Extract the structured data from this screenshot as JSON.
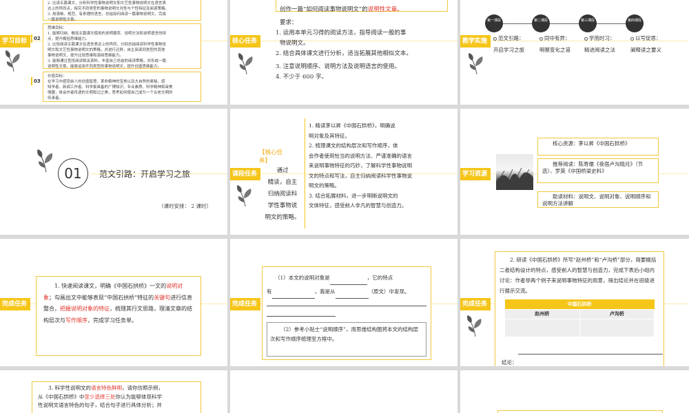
{
  "s1": {
    "label": "学习目标",
    "top_lines": [
      "2. 比读五篇课文，分析科学性事物说明文和文艺性事物说明文在语言表",
      "达上的异同点，探究不同类型的事物说明文共性与个性特征及阅读策略。",
      "3. 用清晰、规范、有条理的语言，总结如何阅读一篇事物说明文，完成",
      "一篇说明性文章。"
    ],
    "n02": "02",
    "box2_title": "思维目标：",
    "box2_lines": [
      "1. 能够归纳、概括五篇课文使用的说明顺序、说明方法和说明语言的特",
      "点，提升概括思维能力。",
      "2. 比较阅读五篇课文在语言表达上的异同，分别总结阅读科学性事物说",
      "明文和文艺性事物说明文的策略，并进行迁移，自主阅读同类型的其他",
      "事物说明文，提升比较思维和演绎思维能力。",
      "3. 能够通过查找阅读相关资料，丰富自己总结的阅读策略，并形成一篇",
      "说明性文章，能够运用不同类型的事物说明文，提升创造思维能力。"
    ],
    "n03": "03",
    "box3_title": "价值目标：",
    "box3_lines": [
      "在学习中感受前人的创造智慧、革命精神的宝贵以及大自然的奥秘，感",
      "知学者、新闻工作者、科学家具备的广博知识、专业素质、科学精神和审美",
      "情趣，体会作者传递的文明和记之美，思考如何使自己成为一个古老文明的",
      "传承者。"
    ]
  },
  "s2": {
    "label": "核心任务",
    "top_text": "创作一篇“如何阅读事物说明文”的",
    "top_red": "说明性文章。",
    "req_title": "要求：",
    "reqs": [
      "1. 运用本单元习得的阅读方法，指导阅读一般的事",
      "物说明文。",
      "2. 结合具体课文进行分析，适当拓展其他相似文本。",
      "3. 注意说明顺序、说明方法及说明语言的使用。",
      "4. 不少于 600 字。"
    ]
  },
  "s3": {
    "label": "教学实施",
    "stages": [
      {
        "circle": "第一课段",
        "name": "范文引路：",
        "sub": "开启学习之旅"
      },
      {
        "circle": "第二课段",
        "name": "同中有异：",
        "sub": "明察变化之道"
      },
      {
        "circle": "第三课段",
        "name": "学而时习：",
        "sub": "精进阅读之法"
      },
      {
        "circle": "第四课段",
        "name": "以写促思：",
        "sub": "阐释读之要义"
      }
    ]
  },
  "s4": {
    "num": "01",
    "title": "范文引路：开启学习之旅",
    "schedule": "（课时安排： 2 课时）"
  },
  "s5": {
    "label": "课段任务",
    "core_tag": "【核心任务】",
    "core_lines": [
      "通过",
      "精读，自主",
      "归纳阅读科",
      "学性事物说",
      "明文的策略。"
    ],
    "tasks": [
      "1. 精读茅以昇《中国石拱桥》，明确说",
      "明对象及其特征。",
      "2. 梳理课文的结构层次和写作顺序，体",
      "会作者使用恰当的说明方法、严谨准确的语言",
      "来说明事物特征的巧妙，了解科学性事物说明",
      "文的特点和写法，自主归纳阅读科学性事物说",
      "明文的策略。",
      "3. 结合拓展材料，进一步明晰说明文的",
      "文体特征，感受前人非凡的智慧与创造力。"
    ]
  },
  "s6": {
    "label": "学习资源",
    "core_res": "核心资源：茅以昇《中国石拱桥》",
    "rec_res": "推荐阅读：陈寿儒《夜宿卢沟晓月》（节选）、罗英《中国桥梁史料》",
    "aux_res": "助读材料：说明文、说明对象、说明顺序和说明方法讲解"
  },
  "s7": {
    "label": "完成任务",
    "p1": "1. 快速阅读课文，明确《中国石拱桥》一文的",
    "p1_red": "说明对象",
    "p2": "；勾画出文中能够表现“中国石拱桥”特征的",
    "p2_red": "关键句",
    "p3": "进行信息整合，",
    "p3_red": "把握说明对象的特征",
    "p4": "，梳理其行文思路，理清文章的结构层次与",
    "p4_red": "写作顺序",
    "p5": "，完成学习任务单。"
  },
  "s8": {
    "label": "完成任务",
    "q1a": "（1）本文的说明对象是",
    "q1b": "，它的特点",
    "q1c": "有",
    "q1d": "，我是从",
    "q1e": "（原文）中发现。",
    "q2": "（2）参考小贴士“说明顺序”，用思维结构图将本文的结构层次和写作顺序梳理至方框中。"
  },
  "s9": {
    "label": "完成任务",
    "text": "2. 研读《中国石拱桥》所写“赵州桥”和“卢沟桥”部分，简要概括二者结构设计的特点，感受前人的智慧与创造力，完成下表后小组内讨论：作者举两个例子来说明事物特征的用意，得出结论并在班级进行展示交流。",
    "table_title": "中国石拱桥",
    "col1": "赵州桥",
    "col2": "卢沟桥",
    "conclusion": "结论："
  },
  "s10": {
    "text1": "3. 科学性说明文的",
    "text1_red": "语言特色鲜明",
    "text2": "，请你仿照示例，",
    "text3": "从《中国石拱桥》中",
    "text3_red": "至少选择三处",
    "text4": "你认为能够体现科学",
    "text5": "性说明文语言特色的句子，结合句子进行具体分析；并"
  }
}
